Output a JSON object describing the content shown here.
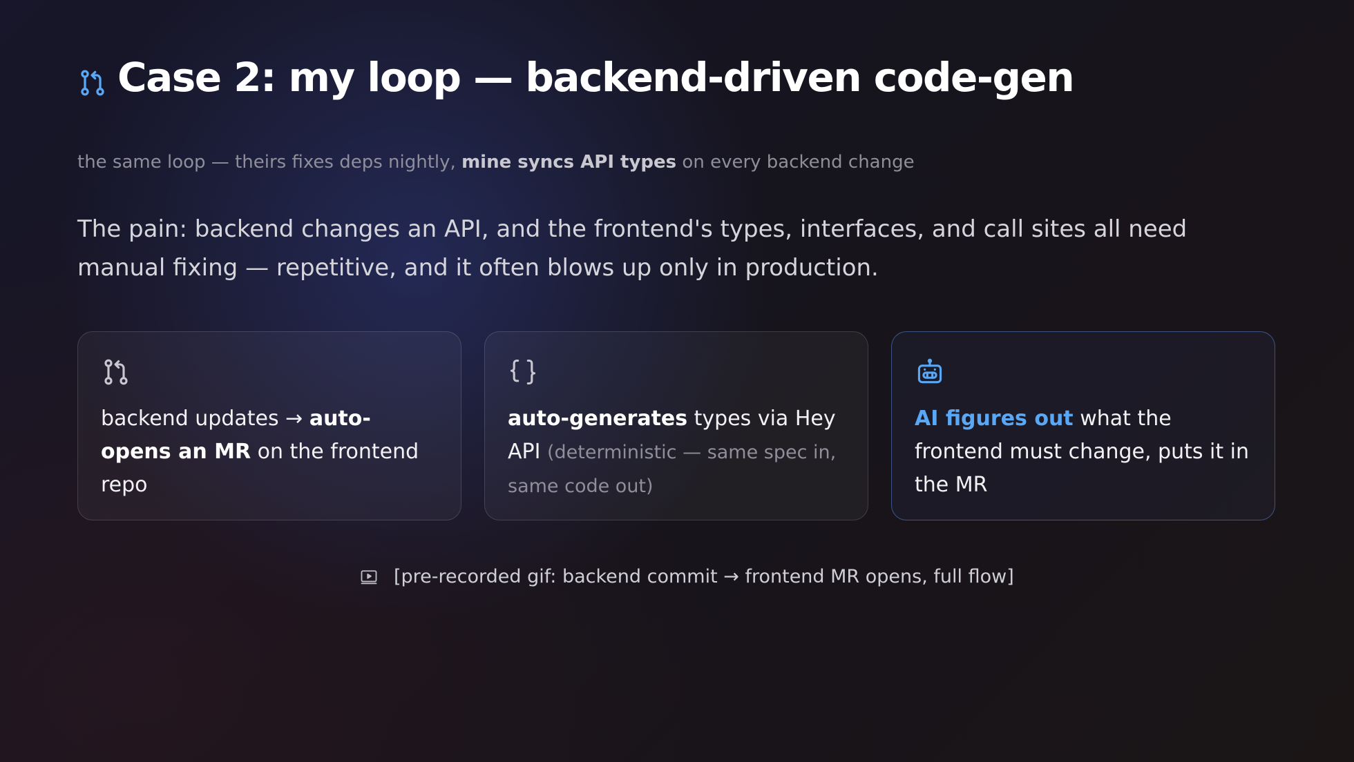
{
  "title": {
    "icon": "git-pull-request-icon",
    "text": "Case 2: my loop — backend-driven code-gen"
  },
  "subtitle": {
    "part1": "the same loop — theirs fixes deps nightly, ",
    "emphasis": "mine syncs API types",
    "part2": " on every backend change"
  },
  "pain": "The pain: backend changes an API, and the frontend's types, interfaces, and call sites all need manual fixing — repetitive, and it often blows up only in production.",
  "cards": [
    {
      "icon": "git-pull-request-icon",
      "bold1": "backend updates → ",
      "bold_a": "auto-opens an MR",
      "rest": " on the frontend repo"
    },
    {
      "icon": "braces-icon",
      "bold": "auto-generates",
      "rest": " types via Hey API ",
      "muted": "(deterministic — same spec in, same code out)"
    },
    {
      "icon": "robot-icon",
      "highlight": "AI figures out",
      "rest": " what the frontend must change, puts it in the MR"
    }
  ],
  "caption": {
    "icon": "video-icon",
    "text": "[pre-recorded gif: backend commit → frontend MR opens, full flow]"
  },
  "colors": {
    "accent_blue": "#5aa7f5",
    "title": "#ffffff",
    "muted": "#8f8e9a",
    "card_border": "#3a3946"
  }
}
